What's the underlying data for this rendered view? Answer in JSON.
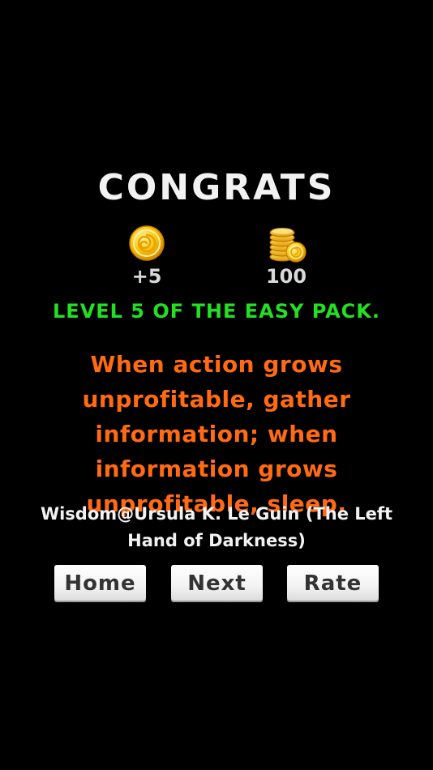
{
  "result": {
    "title": "CONGRATS",
    "coins_earned": "+5",
    "coins_total": "100",
    "level_message": "LEVEL 5 OF THE EASY PACK."
  },
  "quote": {
    "text": "When action grows unprofitable, gather information; when information grows unprofitable, sleep.",
    "attribution": "Wisdom@Ursula K. Le Guin (The Left Hand of Darkness)"
  },
  "buttons": {
    "home": "Home",
    "next": "Next",
    "rate": "Rate"
  },
  "icons": {
    "earned": "gold-coin-icon",
    "total": "coin-stack-icon"
  },
  "colors": {
    "background": "#000000",
    "title": "#f2f2f2",
    "level": "#22e022",
    "quote": "#ff6a13",
    "coin_gold": "#f5b800"
  }
}
